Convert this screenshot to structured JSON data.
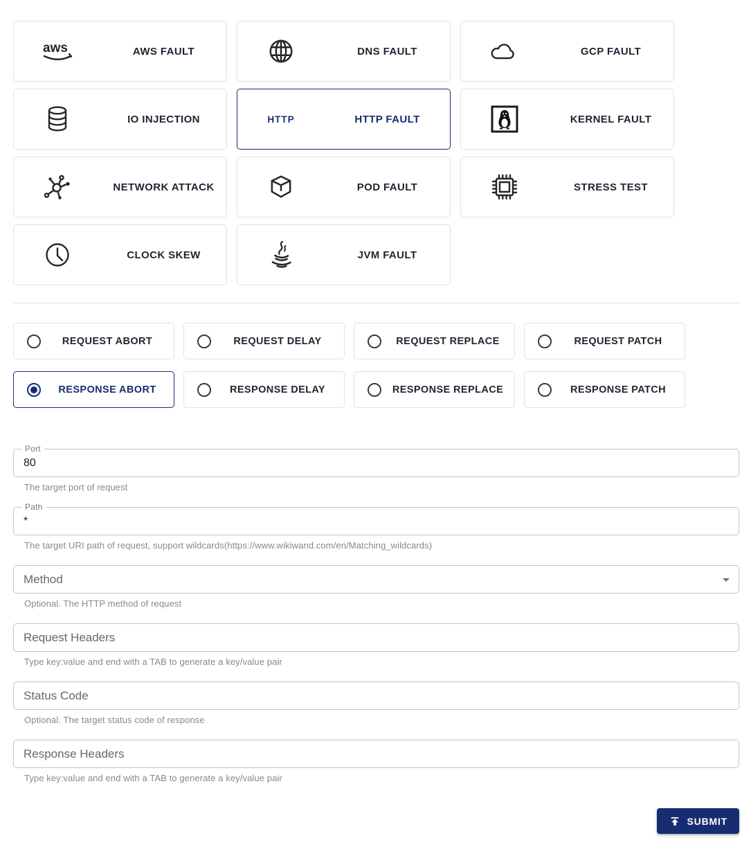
{
  "theme": {
    "primary": "#172d72",
    "text": "#1e2430",
    "helper_gray": "#888888",
    "card_border": "#e2e2e2",
    "input_border": "#c4c4c4"
  },
  "fault_types": [
    {
      "id": "aws",
      "label": "AWS FAULT",
      "icon": "aws-icon",
      "selected": false
    },
    {
      "id": "dns",
      "label": "DNS FAULT",
      "icon": "globe-icon",
      "selected": false
    },
    {
      "id": "gcp",
      "label": "GCP FAULT",
      "icon": "cloud-icon",
      "selected": false
    },
    {
      "id": "io",
      "label": "IO INJECTION",
      "icon": "database-icon",
      "selected": false
    },
    {
      "id": "http",
      "label": "HTTP FAULT",
      "icon": "http-text-icon",
      "icon_text": "HTTP",
      "selected": true
    },
    {
      "id": "kernel",
      "label": "KERNEL FAULT",
      "icon": "linux-penguin-icon",
      "selected": false
    },
    {
      "id": "network",
      "label": "NETWORK ATTACK",
      "icon": "network-nodes-icon",
      "selected": false
    },
    {
      "id": "pod",
      "label": "POD FAULT",
      "icon": "cube-icon",
      "selected": false
    },
    {
      "id": "stress",
      "label": "STRESS TEST",
      "icon": "cpu-chip-icon",
      "selected": false
    },
    {
      "id": "clock",
      "label": "CLOCK SKEW",
      "icon": "clock-icon",
      "selected": false
    },
    {
      "id": "jvm",
      "label": "JVM FAULT",
      "icon": "java-cup-icon",
      "selected": false
    }
  ],
  "actions": [
    {
      "id": "request-abort",
      "label": "REQUEST ABORT",
      "selected": false
    },
    {
      "id": "request-delay",
      "label": "REQUEST DELAY",
      "selected": false
    },
    {
      "id": "request-replace",
      "label": "REQUEST REPLACE",
      "selected": false
    },
    {
      "id": "request-patch",
      "label": "REQUEST PATCH",
      "selected": false
    },
    {
      "id": "response-abort",
      "label": "RESPONSE ABORT",
      "selected": true
    },
    {
      "id": "response-delay",
      "label": "RESPONSE DELAY",
      "selected": false
    },
    {
      "id": "response-replace",
      "label": "RESPONSE REPLACE",
      "selected": false
    },
    {
      "id": "response-patch",
      "label": "RESPONSE PATCH",
      "selected": false
    }
  ],
  "form": {
    "port": {
      "label": "Port",
      "value": "80",
      "helper": "The target port of request"
    },
    "path": {
      "label": "Path",
      "value": "*",
      "helper": "The target URI path of request, support wildcards(https://www.wikiwand.com/en/Matching_wildcards)"
    },
    "method": {
      "label": "Method",
      "value": "",
      "helper": "Optional. The HTTP method of request"
    },
    "request_headers": {
      "label": "Request Headers",
      "value": "",
      "helper": "Type key:value and end with a TAB to generate a key/value pair"
    },
    "status_code": {
      "label": "Status Code",
      "value": "",
      "helper": "Optional. The target status code of response"
    },
    "response_headers": {
      "label": "Response Headers",
      "value": "",
      "helper": "Type key:value and end with a TAB to generate a key/value pair"
    }
  },
  "submit": {
    "label": "SUBMIT",
    "icon": "publish-icon"
  }
}
